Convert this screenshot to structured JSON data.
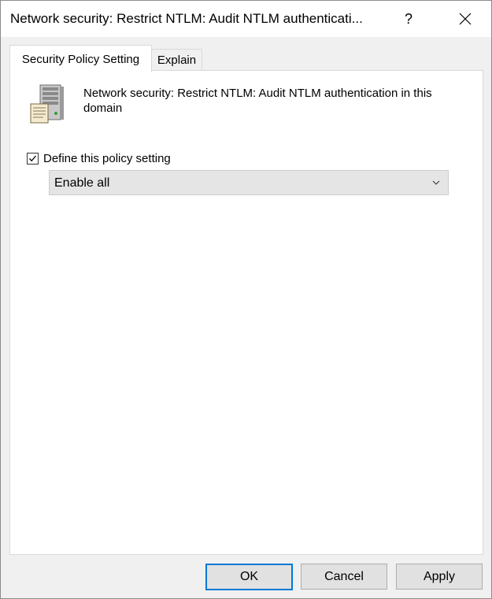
{
  "window": {
    "title": "Network security: Restrict NTLM: Audit NTLM authenticati...",
    "help_label": "?",
    "close_icon": "close-icon"
  },
  "tabs": [
    {
      "label": "Security Policy Setting",
      "active": true
    },
    {
      "label": "Explain",
      "active": false
    }
  ],
  "policy": {
    "icon": "server-policy-icon",
    "description": "Network security: Restrict NTLM: Audit NTLM authentication in this domain",
    "define_label": "Define this policy setting",
    "define_checked": true,
    "selected_option": "Enable all"
  },
  "buttons": {
    "ok": "OK",
    "cancel": "Cancel",
    "apply": "Apply"
  },
  "colors": {
    "default_button_border": "#0078d7",
    "dialog_background": "#f0f0f0",
    "panel_background": "#ffffff"
  }
}
